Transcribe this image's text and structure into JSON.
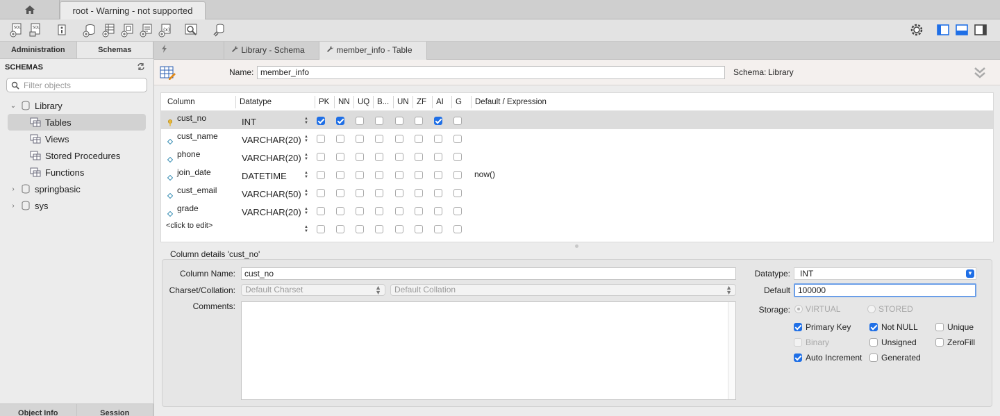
{
  "window": {
    "connection_tab": "root - Warning - not supported"
  },
  "sidebar": {
    "tabs": [
      "Administration",
      "Schemas"
    ],
    "header": "SCHEMAS",
    "filter_placeholder": "Filter objects",
    "tree": [
      {
        "label": "Library"
      },
      {
        "label": "Tables"
      },
      {
        "label": "Views"
      },
      {
        "label": "Stored Procedures"
      },
      {
        "label": "Functions"
      },
      {
        "label": "springbasic"
      },
      {
        "label": "sys"
      }
    ],
    "bottom_tabs": [
      "Object Info",
      "Session"
    ]
  },
  "editor_tabs": [
    {
      "label": "Library - Schema"
    },
    {
      "label": "member_info - Table"
    }
  ],
  "table_editor": {
    "name_label": "Name:",
    "name_value": "member_info",
    "schema_label": "Schema:",
    "schema_value": "Library"
  },
  "grid": {
    "headers": [
      "Column",
      "Datatype",
      "PK",
      "NN",
      "UQ",
      "B...",
      "UN",
      "ZF",
      "AI",
      "G",
      "Default / Expression"
    ],
    "rows": [
      {
        "name": "cust_no",
        "type": "INT",
        "flags": [
          1,
          1,
          0,
          0,
          0,
          0,
          1,
          0
        ],
        "default": ""
      },
      {
        "name": "cust_name",
        "type": "VARCHAR(20)",
        "flags": [
          0,
          0,
          0,
          0,
          0,
          0,
          0,
          0
        ],
        "default": ""
      },
      {
        "name": "phone",
        "type": "VARCHAR(20)",
        "flags": [
          0,
          0,
          0,
          0,
          0,
          0,
          0,
          0
        ],
        "default": ""
      },
      {
        "name": "join_date",
        "type": "DATETIME",
        "flags": [
          0,
          0,
          0,
          0,
          0,
          0,
          0,
          0
        ],
        "default": "now()"
      },
      {
        "name": "cust_email",
        "type": "VARCHAR(50)",
        "flags": [
          0,
          0,
          0,
          0,
          0,
          0,
          0,
          0
        ],
        "default": ""
      },
      {
        "name": "grade",
        "type": "VARCHAR(20)",
        "flags": [
          0,
          0,
          0,
          0,
          0,
          0,
          0,
          0
        ],
        "default": ""
      }
    ],
    "new_row_placeholder": "<click to edit>"
  },
  "details": {
    "title": "Column details 'cust_no'",
    "column_name_label": "Column Name:",
    "column_name": "cust_no",
    "charset_label": "Charset/Collation:",
    "charset": "Default Charset",
    "collation": "Default Collation",
    "comments_label": "Comments:",
    "datatype_label": "Datatype:",
    "datatype": "INT",
    "default_label": "Default",
    "default_value": "100000",
    "storage_label": "Storage:",
    "storage_virtual": "VIRTUAL",
    "storage_stored": "STORED",
    "options": {
      "primary_key": "Primary Key",
      "not_null": "Not NULL",
      "unique": "Unique",
      "binary": "Binary",
      "unsigned": "Unsigned",
      "zerofill": "ZeroFill",
      "auto_increment": "Auto Increment",
      "generated": "Generated"
    }
  },
  "colors": {
    "accent": "#1f6fe6",
    "selection": "#d2d2d2"
  }
}
